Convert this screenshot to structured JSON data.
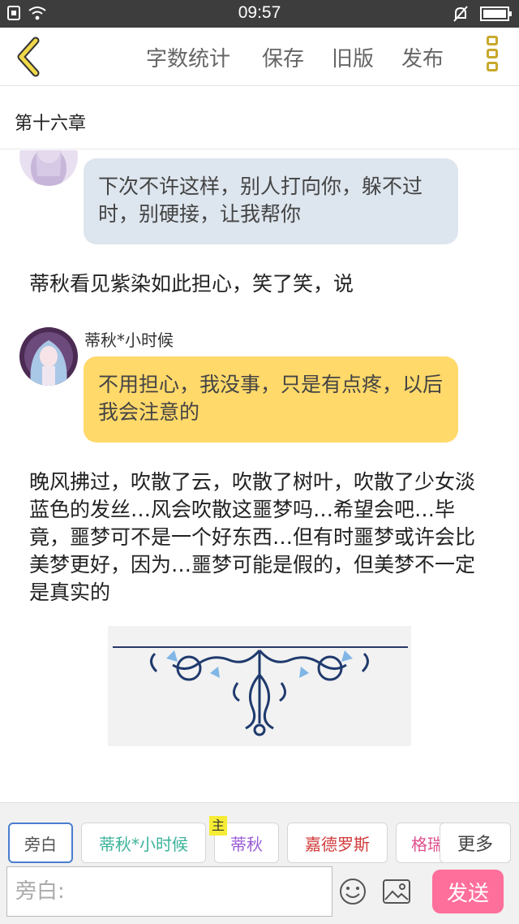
{
  "status_bar": {
    "time": "09:57"
  },
  "toolbar": {
    "word_count": "字数统计",
    "save": "保存",
    "old_version": "旧版",
    "publish": "发布"
  },
  "chapter": {
    "title": "第十六章"
  },
  "messages": {
    "bubble1": "下次不许这样，别人打向你，躲不过时，别硬接，让我帮你",
    "narration1": "蒂秋看见紫染如此担心，笑了笑，说",
    "speaker2": "蒂秋*小时候",
    "bubble2": "不用担心，我没事，只是有点疼，以后我会注意的",
    "narration2": "晚风拂过，吹散了云，吹散了树叶，吹散了少女淡蓝色的发丝…风会吹散这噩梦吗…希望会吧…毕竟，噩梦可不是一个好东西…但有时噩梦或许会比美梦更好，因为…噩梦可能是假的，但美梦不一定是真实的"
  },
  "roles": {
    "items": [
      "旁白",
      "蒂秋*小时候",
      "蒂秋",
      "嘉德罗斯",
      "格瑞"
    ],
    "main_badge": "主",
    "more": "更多"
  },
  "composer": {
    "placeholder": "旁白:",
    "send": "发送"
  },
  "colors": {
    "bubble_blue": "#dde5ee",
    "bubble_yellow": "#ffd96a",
    "send": "#ff6f9c",
    "accent": "#c8a92c"
  }
}
